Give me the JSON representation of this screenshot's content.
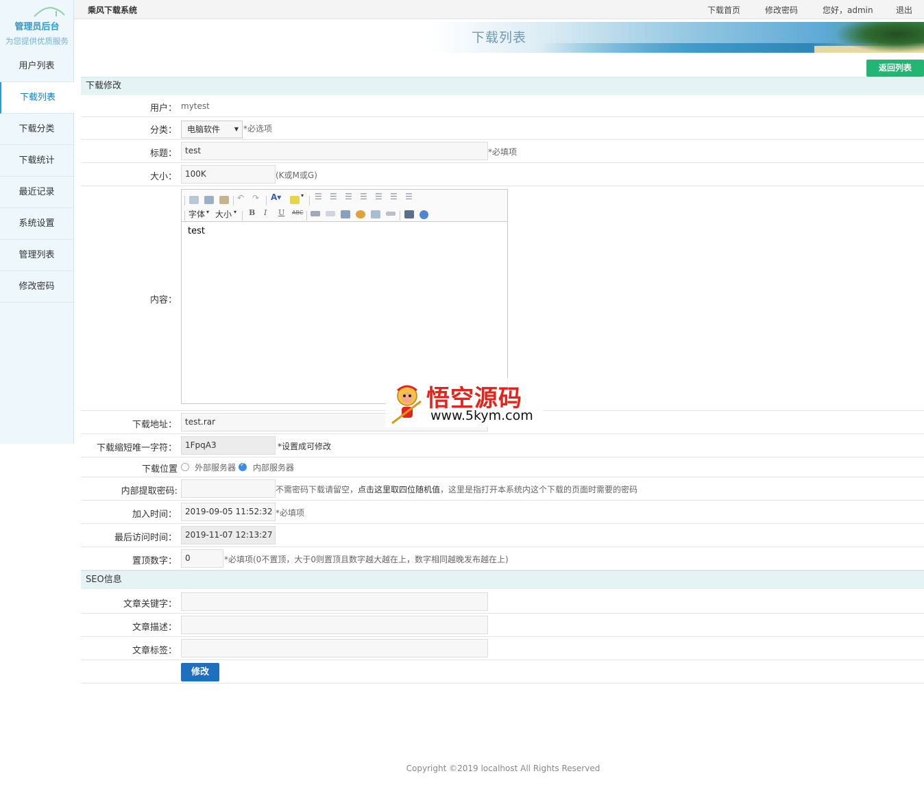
{
  "sidebar": {
    "title": "管理员后台",
    "subtitle": "为您提供优质服务",
    "items": [
      {
        "label": "用户列表"
      },
      {
        "label": "下载列表",
        "active": true
      },
      {
        "label": "下载分类"
      },
      {
        "label": "下载统计"
      },
      {
        "label": "最近记录"
      },
      {
        "label": "系统设置"
      },
      {
        "label": "管理列表"
      },
      {
        "label": "修改密码"
      }
    ]
  },
  "topbar": {
    "system_name": "乘风下载系统",
    "links": {
      "home": "下载首页",
      "change_password": "修改密码",
      "greeting": "您好，admin",
      "logout": "退出"
    }
  },
  "banner": {
    "title": "下载列表"
  },
  "back_button": "返回列表",
  "form": {
    "section_title": "下载修改",
    "user": {
      "label": "用户：",
      "value": "mytest"
    },
    "category": {
      "label": "分类：",
      "value": "电脑软件",
      "hint": "*必选项"
    },
    "title": {
      "label": "标题：",
      "value": "test",
      "hint": "*必填项"
    },
    "size": {
      "label": "大小：",
      "value": "100K",
      "hint": "(K或M或G)"
    },
    "content": {
      "label": "内容：",
      "value": "test",
      "toolbar": {
        "font_label": "字体",
        "size_label": "大小"
      }
    },
    "download_url": {
      "label": "下载地址：",
      "value": "test.rar"
    },
    "short_code": {
      "label": "下载缩短唯一字符：",
      "value": "1FpqA3",
      "hint": "*设置成可修改"
    },
    "location": {
      "label": "下载位置",
      "options": [
        {
          "label": "外部服务器",
          "checked": false
        },
        {
          "label": "内部服务器",
          "checked": true
        }
      ]
    },
    "extract_password": {
      "label": "内部提取密码:",
      "value": "",
      "hint_before": "不需密码下载请留空，",
      "hint_link": "点击这里取四位随机值",
      "hint_after": "，这里是指打开本系统内这个下载的页面时需要的密码"
    },
    "add_time": {
      "label": "加入时间：",
      "value": "2019-09-05 11:52:32",
      "hint": "*必填项"
    },
    "last_visit": {
      "label": "最后访问时间：",
      "value": "2019-11-07 12:13:27"
    },
    "top_number": {
      "label": "置顶数字：",
      "value": "0",
      "hint": "*必填项(0不置顶，大于0则置顶且数字越大越在上，数字相同越晚发布越在上)"
    }
  },
  "seo": {
    "section_title": "SEO信息",
    "keywords": {
      "label": "文章关键字：",
      "value": ""
    },
    "description": {
      "label": "文章描述：",
      "value": ""
    },
    "tags": {
      "label": "文章标签：",
      "value": ""
    }
  },
  "submit_button": "修改",
  "watermark": {
    "title": "悟空源码",
    "url": "www.5kym.com"
  },
  "footer": "Copyright ©2019 localhost All Rights Reserved",
  "colors": {
    "accent": "#2b9ad6",
    "back_button": "#23b574",
    "submit_button": "#1e6fc0",
    "section_bg": "#e6f3f5",
    "watermark_red": "#e5231a"
  }
}
